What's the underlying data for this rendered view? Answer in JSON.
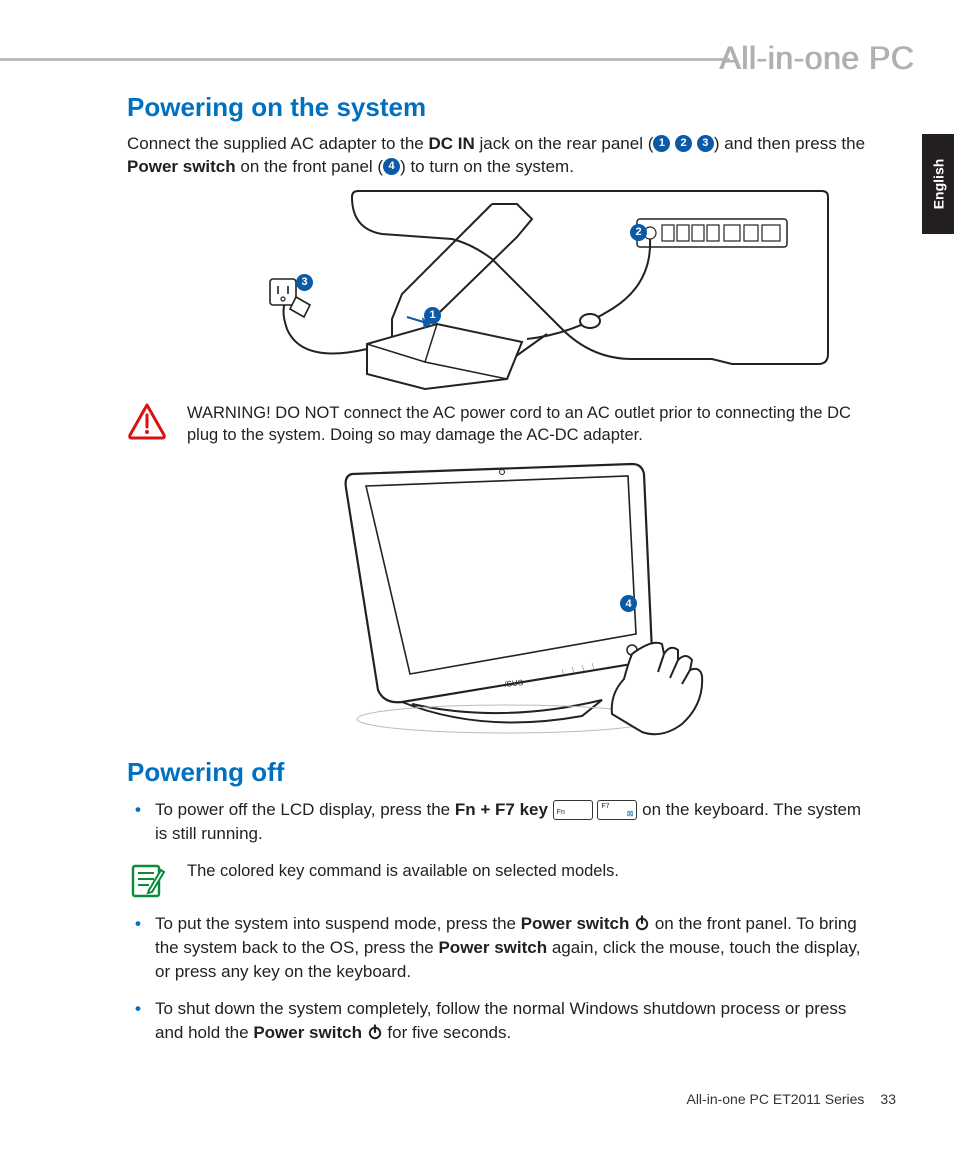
{
  "header": {
    "product": "All-in-one PC",
    "language_tab": "English"
  },
  "section1": {
    "heading": "Powering on the system",
    "p1_a": "Connect the supplied AC adapter to the ",
    "p1_b": "DC IN",
    "p1_c": " jack on the rear panel (",
    "p1_d": ") and then press the ",
    "p1_e": "Power switch",
    "p1_f": " on the front panel (",
    "p1_g": ") to turn on the system.",
    "badges_rear": [
      "1",
      "2",
      "3"
    ],
    "badge_front": "4"
  },
  "fig1": {
    "b1": "1",
    "b2": "2",
    "b3": "3"
  },
  "warning": {
    "text": "WARNING! DO NOT connect the AC power cord to an AC outlet prior to connecting the DC plug to the system. Doing so may damage the AC-DC adapter."
  },
  "fig2": {
    "b4": "4"
  },
  "section2": {
    "heading": "Powering off",
    "li1_a": "To power off the LCD display, press the ",
    "li1_b": "Fn + F7 key",
    "li1_c": " on the keyboard. The system is still running.",
    "note": "The colored key command is available on selected models.",
    "li2_a": "To put the system into suspend mode, press the ",
    "li2_b": "Power switch",
    "li2_c": " on the front panel. To bring the system back to the OS, press the ",
    "li2_d": "Power switch",
    "li2_e": " again, click the mouse, touch the display, or press any key on the keyboard.",
    "li3_a": "To shut down the system completely, follow the normal Windows shutdown process or press and hold the ",
    "li3_b": "Power switch",
    "li3_c": " for five seconds."
  },
  "footer": {
    "model": "All-in-one PC ET2011 Series",
    "page": "33"
  }
}
